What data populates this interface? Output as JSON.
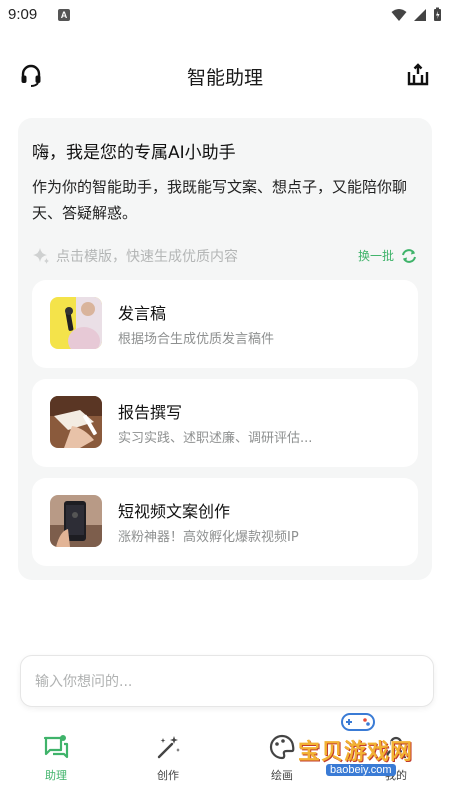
{
  "status_bar": {
    "time": "9:09",
    "notification_badge": "A"
  },
  "header": {
    "title": "智能助理"
  },
  "card": {
    "greeting": "嗨，我是您的专属AI小助手",
    "intro": "作为你的智能助手，我既能写文案、想点子，又能陪你聊天、答疑解惑。",
    "template_hint": "点击模版，快速生成优质内容",
    "refresh_label": "换一批",
    "templates": [
      {
        "title": "发言稿",
        "desc": "根据场合生成优质发言稿件"
      },
      {
        "title": "报告撰写",
        "desc": "实习实践、述职述廉、调研评估..."
      },
      {
        "title": "短视频文案创作",
        "desc": "涨粉神器！高效孵化爆款视频IP"
      }
    ]
  },
  "input": {
    "placeholder": "输入你想问的..."
  },
  "nav": {
    "items": [
      {
        "label": "助理"
      },
      {
        "label": "创作"
      },
      {
        "label": "绘画"
      },
      {
        "label": "我的"
      }
    ]
  },
  "watermark": {
    "text": "宝贝游戏网",
    "url": "baobeiy.com"
  },
  "colors": {
    "accent": "#3fb36a",
    "card_bg": "#f5f6f6",
    "muted": "#8e9090"
  }
}
